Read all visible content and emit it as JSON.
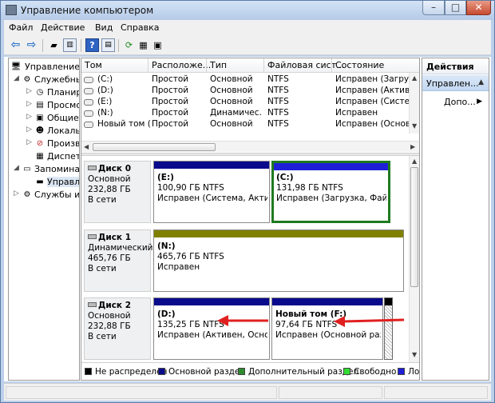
{
  "window": {
    "title": "Управление компьютером",
    "min": "–",
    "max": "□",
    "close": "✕"
  },
  "menu": [
    "Файл",
    "Действие",
    "Вид",
    "Справка"
  ],
  "tree": [
    {
      "label": "Управление компьютером (л",
      "level": 0,
      "exp": "",
      "icon": "computer-icon",
      "glyph": "🖥"
    },
    {
      "label": "Служебные программы",
      "level": 1,
      "exp": "◢",
      "icon": "tools-icon",
      "glyph": "⚙"
    },
    {
      "label": "Планировщик заданий",
      "level": 2,
      "exp": "▷",
      "icon": "scheduler-icon",
      "glyph": "◷"
    },
    {
      "label": "Просмотр событий",
      "level": 2,
      "exp": "▷",
      "icon": "event-viewer-icon",
      "glyph": "▤"
    },
    {
      "label": "Общие папки",
      "level": 2,
      "exp": "▷",
      "icon": "shared-folder-icon",
      "glyph": "▣"
    },
    {
      "label": "Локальные пользователи",
      "level": 2,
      "exp": "▷",
      "icon": "users-icon",
      "glyph": "☻"
    },
    {
      "label": "Производительность",
      "level": 2,
      "exp": "▷",
      "icon": "performance-icon",
      "glyph": "⊘"
    },
    {
      "label": "Диспетчер устройств",
      "level": 2,
      "exp": "",
      "icon": "device-manager-icon",
      "glyph": "▦"
    },
    {
      "label": "Запоминающие устройства",
      "level": 1,
      "exp": "◢",
      "icon": "storage-icon",
      "glyph": "▭"
    },
    {
      "label": "Управление дисками",
      "level": 2,
      "exp": "",
      "icon": "disk-management-icon",
      "glyph": "▬",
      "selected": true
    },
    {
      "label": "Службы и приложения",
      "level": 1,
      "exp": "▷",
      "icon": "services-icon",
      "glyph": "⚙"
    }
  ],
  "volumes": {
    "headers": [
      "Том",
      "Расположе...",
      "Тип",
      "Файловая сист...",
      "Состояние"
    ],
    "rows": [
      [
        "(C:)",
        "Простой",
        "Основной",
        "NTFS",
        "Исправен (Загрузка,"
      ],
      [
        "(D:)",
        "Простой",
        "Основной",
        "NTFS",
        "Исправен (Активен,"
      ],
      [
        "(E:)",
        "Простой",
        "Основной",
        "NTFS",
        "Исправен (Система,"
      ],
      [
        "(N:)",
        "Простой",
        "Динамичес...",
        "NTFS",
        "Исправен"
      ],
      [
        "Новый том (F:)",
        "Простой",
        "Основной",
        "NTFS",
        "Исправен (Основной"
      ]
    ]
  },
  "disks": [
    {
      "name": "Диск 0",
      "type": "Основной",
      "size": "232,88 ГБ",
      "status": "В сети",
      "partitions": [
        {
          "label": "(E:)",
          "size": "100,90 ГБ NTFS",
          "status": "Исправен (Система, Активен",
          "color": "#0a0a8c"
        },
        {
          "label": "(C:)",
          "size": "131,98 ГБ NTFS",
          "status": "Исправен (Загрузка, Файл п",
          "color": "#0a0a8c",
          "selected": true
        }
      ]
    },
    {
      "name": "Диск 1",
      "type": "Динамический",
      "size": "465,76 ГБ",
      "status": "В сети",
      "partitions": [
        {
          "label": "(N:)",
          "size": "465,76 ГБ NTFS",
          "status": "Исправен",
          "color": "#808000"
        }
      ]
    },
    {
      "name": "Диск 2",
      "type": "Основной",
      "size": "232,88 ГБ",
      "status": "В сети",
      "partitions": [
        {
          "label": "(D:)",
          "size": "135,25 ГБ NTFS",
          "status": "Исправен (Активен, Основно",
          "color": "#0a0a8c"
        },
        {
          "label": "Новый том  (F:)",
          "size": "97,64 ГБ NTFS",
          "status": "Исправен (Основной разде",
          "color": "#0a0a8c"
        }
      ]
    }
  ],
  "legend": [
    {
      "label": "Не распределен",
      "color": "#000000"
    },
    {
      "label": "Основной раздел",
      "color": "#0a0a8c"
    },
    {
      "label": "Дополнительный раздел",
      "color": "#2e8b2e"
    },
    {
      "label": "Свободно",
      "color": "#33dd33"
    },
    {
      "label": "Ло",
      "color": "#1f1fd8"
    }
  ],
  "actions": {
    "header": "Действия",
    "group": "Управлен...",
    "item": "Допо..."
  },
  "colors": {
    "accent": "#0a0a8c",
    "selected_border": "#1f7a1f",
    "arrow": "#e02020"
  }
}
